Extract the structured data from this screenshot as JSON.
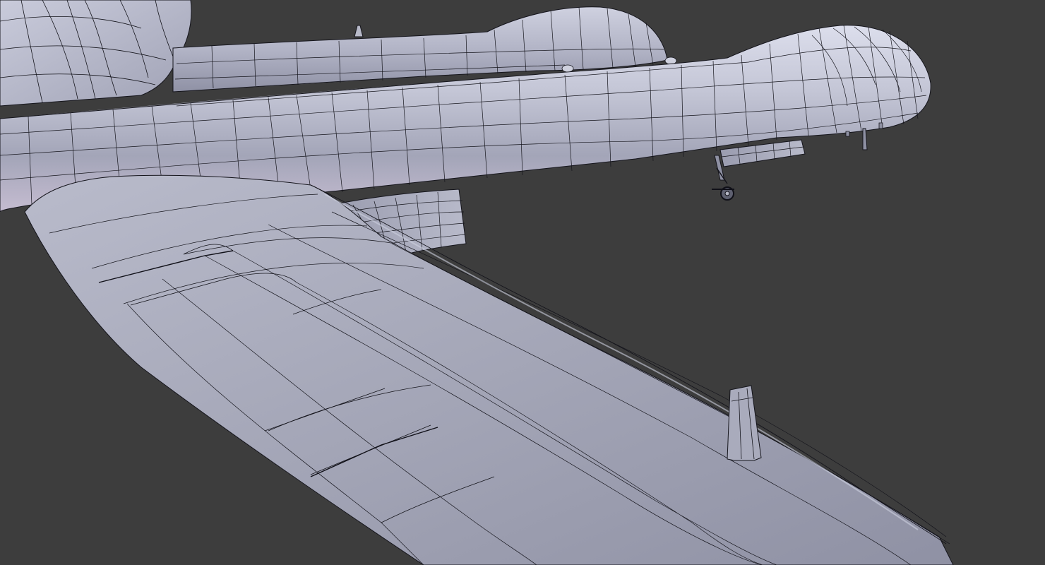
{
  "viewport": {
    "background": "#3d3d3d",
    "shading_mode": "solid",
    "overlay": "wireframe",
    "mesh": {
      "surface_base": "#a8aabb",
      "surface_light": "#d4d6e6",
      "surface_dark": "#7e8096",
      "edge_color": "#101018",
      "underside_tint": "#bfb6cc"
    },
    "visible_parts": [
      "fuselage",
      "left-wing",
      "engine-nacelle-outer",
      "engine-nacelle-inner",
      "wing-fillet",
      "nacelle-fairing",
      "wing-fence",
      "main-landing-gear",
      "nose-strut",
      "antenna"
    ]
  }
}
